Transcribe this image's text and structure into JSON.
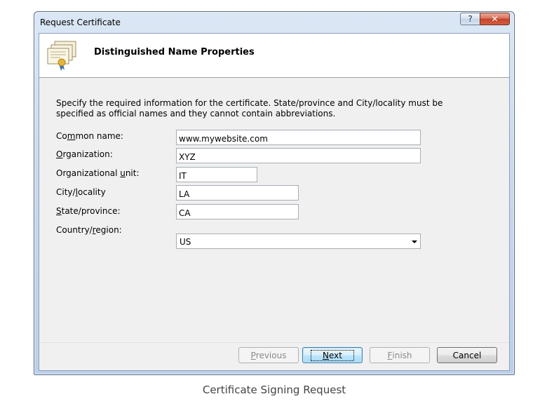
{
  "window": {
    "title": "Request Certificate",
    "help_label": "?",
    "close_label": "✕"
  },
  "header": {
    "title": "Distinguished Name Properties"
  },
  "description": "Specify the required information for the certificate. State/province and City/locality must be specified as official names and they cannot contain abbreviations.",
  "fields": {
    "common_name": {
      "label_pre": "Co",
      "label_key": "m",
      "label_post": "mon name:",
      "value": "www.mywebsite.com"
    },
    "organization": {
      "label_pre": "",
      "label_key": "O",
      "label_post": "rganization:",
      "value": "XYZ"
    },
    "org_unit": {
      "label_pre": "Organizational ",
      "label_key": "u",
      "label_post": "nit:",
      "value": "IT"
    },
    "city": {
      "label_pre": "City/",
      "label_key": "l",
      "label_post": "ocality",
      "value": "LA"
    },
    "state": {
      "label_pre": "",
      "label_key": "S",
      "label_post": "tate/province:",
      "value": "CA"
    },
    "country": {
      "label_pre": "Country/",
      "label_key": "r",
      "label_post": "egion:",
      "value": "US"
    }
  },
  "buttons": {
    "previous": {
      "key": "P",
      "rest": "revious"
    },
    "next": {
      "key": "N",
      "rest": "ext"
    },
    "finish": {
      "key": "F",
      "rest": "inish"
    },
    "cancel": "Cancel"
  },
  "caption": "Certificate Signing Request",
  "colors": {
    "close_button": "#c2442b",
    "default_button_border": "#3c7fb1",
    "dialog_background": "#f0f0f0"
  },
  "icons": {
    "header_icon": "certificate-icon",
    "dropdown": "chevron-down-icon"
  }
}
